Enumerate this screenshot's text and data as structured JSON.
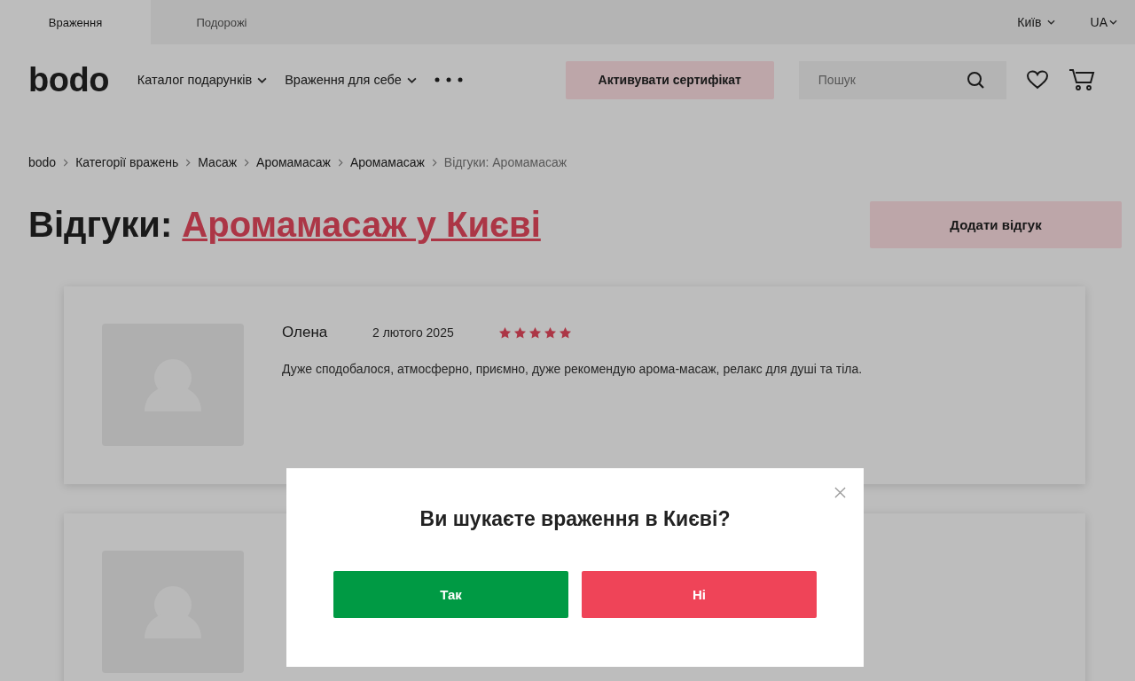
{
  "top_tabs": [
    {
      "label": "Враження",
      "selected": true
    },
    {
      "label": "Подорожі",
      "selected": false
    }
  ],
  "city": "Київ",
  "language": "UA",
  "logo": "bodo",
  "nav": [
    {
      "label": "Каталог подарунків"
    },
    {
      "label": "Враження для себе"
    }
  ],
  "activate_button": "Активувати сертифікат",
  "search": {
    "placeholder": "Пошук"
  },
  "breadcrumbs": [
    {
      "label": "bodo",
      "current": false
    },
    {
      "label": "Категорії вражень",
      "current": false
    },
    {
      "label": "Масаж",
      "current": false
    },
    {
      "label": "Аромамасаж",
      "current": false
    },
    {
      "label": "Аромамасаж",
      "current": false
    },
    {
      "label": "Відгуки: Аромамасаж",
      "current": true
    }
  ],
  "heading": {
    "prefix": "Відгуки:",
    "link": "Аромамасаж у Києві"
  },
  "add_review_button": "Додати відгук",
  "reviews": [
    {
      "kind": "review",
      "name": "Олена",
      "date": "2 лютого 2025",
      "stars": 5,
      "text": "Дуже сподобалося, атмосферно, приємно, дуже рекомендую арома-масаж, релакс для душі та тіла."
    },
    {
      "kind": "covered"
    }
  ],
  "modal": {
    "question": "Ви шукаєте враження в Києві?",
    "buttons": [
      {
        "label": "Так",
        "kind": "confirm"
      },
      {
        "label": "Ні",
        "kind": "decline"
      }
    ]
  }
}
